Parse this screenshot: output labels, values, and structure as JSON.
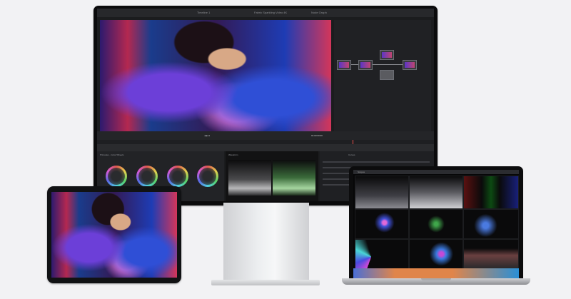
{
  "monitor": {
    "project_title": "Fabric Sparkling Video 4K",
    "timeline_name": "Timeline 1",
    "panel_title": "Node Graph",
    "wheels_title": "Primaries - Color Wheels",
    "scopes_title": "Waveform",
    "curves_title": "Curves",
    "timecode": "01:00:00:00"
  },
  "ipad": {},
  "macbook": {
    "app_title": "Scopes",
    "tabs": [
      "Waveform",
      "Parade",
      "Vectorscope"
    ]
  },
  "colors": {
    "accent": "#e8504a",
    "wheel_bg": "#2a2b2e"
  }
}
